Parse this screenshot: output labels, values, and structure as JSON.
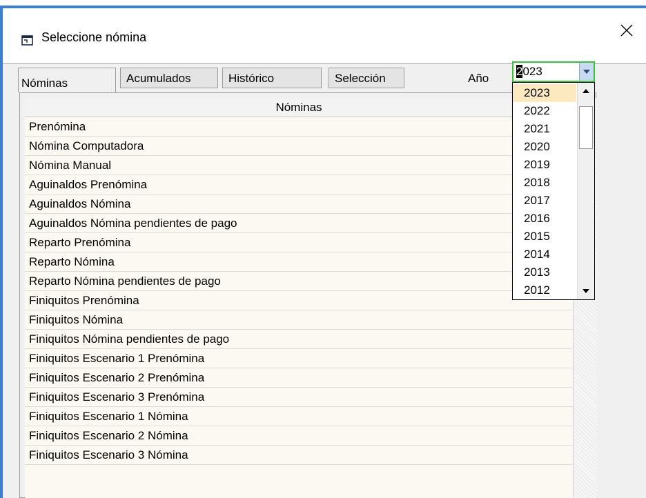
{
  "window": {
    "title": "Seleccione nómina",
    "close_label": "close"
  },
  "tabs": [
    {
      "label": "Nóminas",
      "active": true
    },
    {
      "label": "Acumulados",
      "active": false
    },
    {
      "label": "Histórico",
      "active": false
    },
    {
      "label": "Selección",
      "active": false
    }
  ],
  "year": {
    "label": "Año",
    "value_first_char": "2",
    "value_rest": "023",
    "options": [
      "2023",
      "2022",
      "2021",
      "2020",
      "2019",
      "2018",
      "2017",
      "2016",
      "2015",
      "2014",
      "2013",
      "2012"
    ],
    "selected": "2023"
  },
  "grid": {
    "header": "Nóminas",
    "rows": [
      "Prenómina",
      "Nómina Computadora",
      "Nómina Manual",
      "Aguinaldos Prenómina",
      "Aguinaldos Nómina",
      "Aguinaldos Nómina pendientes de pago",
      "Reparto Prenómina",
      "Reparto Nómina",
      "Reparto Nómina pendientes de pago",
      "Finiquitos Prenómina",
      "Finiquitos Nómina",
      "Finiquitos Nómina pendientes de pago",
      "Finiquitos Escenario 1 Prenómina",
      "Finiquitos Escenario 2 Prenómina",
      "Finiquitos Escenario 3 Prenómina",
      "Finiquitos Escenario 1 Nómina",
      "Finiquitos Escenario 2 Nómina",
      "Finiquitos Escenario 3 Nómina"
    ]
  },
  "colors": {
    "frame": "#3c7fd1",
    "combo_border": "#34c734",
    "selected_option": "#fde9c0",
    "grid_bg": "#fbf9f1"
  },
  "icons": {
    "window_icon": "window-icon",
    "close_icon": "close-icon",
    "dropdown_icon": "chevron-down-icon"
  }
}
